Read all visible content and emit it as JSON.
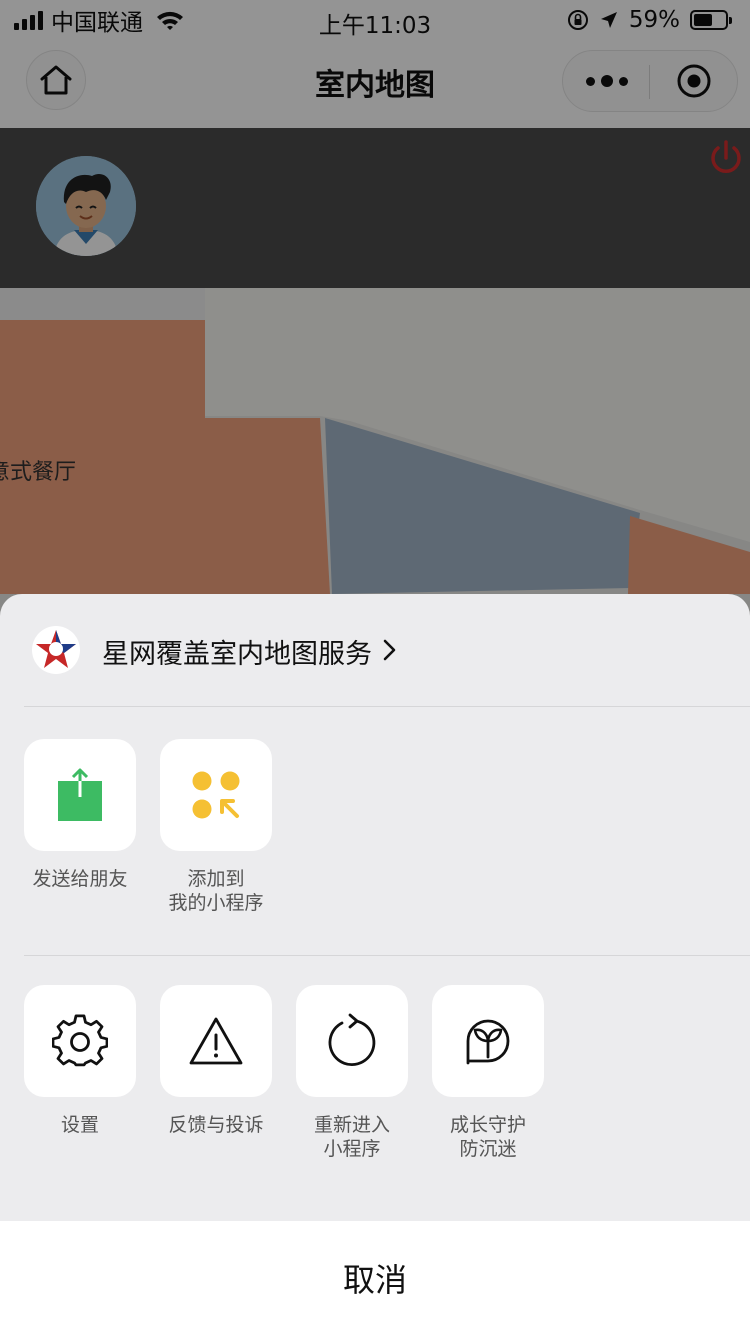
{
  "status_bar": {
    "carrier": "中国联通",
    "time": "上午11:03",
    "battery_percent": "59%",
    "battery_level": 0.59
  },
  "navbar": {
    "title": "室内地图",
    "home_icon": "home-icon",
    "more_icon": "more-dots-icon",
    "close_icon": "target-close-icon"
  },
  "user": {
    "avatar_icon": "avatar-boy",
    "power_icon": "power-icon",
    "power_color": "#d32f2f"
  },
  "map": {
    "label": "意式餐厅",
    "colors": {
      "orange": "#f0a07c",
      "blue": "#9cb0c2",
      "light": "#f7f7f2",
      "gray": "#e5e5e5"
    }
  },
  "sheet": {
    "app_name": "星网覆盖室内地图服务",
    "row1": [
      {
        "label": "发送给朋友",
        "icon": "share-icon"
      },
      {
        "label": "添加到\n我的小程序",
        "icon": "add-mini-program-icon"
      }
    ],
    "row2": [
      {
        "label": "设置",
        "icon": "gear-icon"
      },
      {
        "label": "反馈与投诉",
        "icon": "warning-icon"
      },
      {
        "label": "重新进入\n小程序",
        "icon": "reload-icon"
      },
      {
        "label": "成长守护\n防沉迷",
        "icon": "sprout-icon"
      }
    ],
    "cancel": "取消"
  }
}
